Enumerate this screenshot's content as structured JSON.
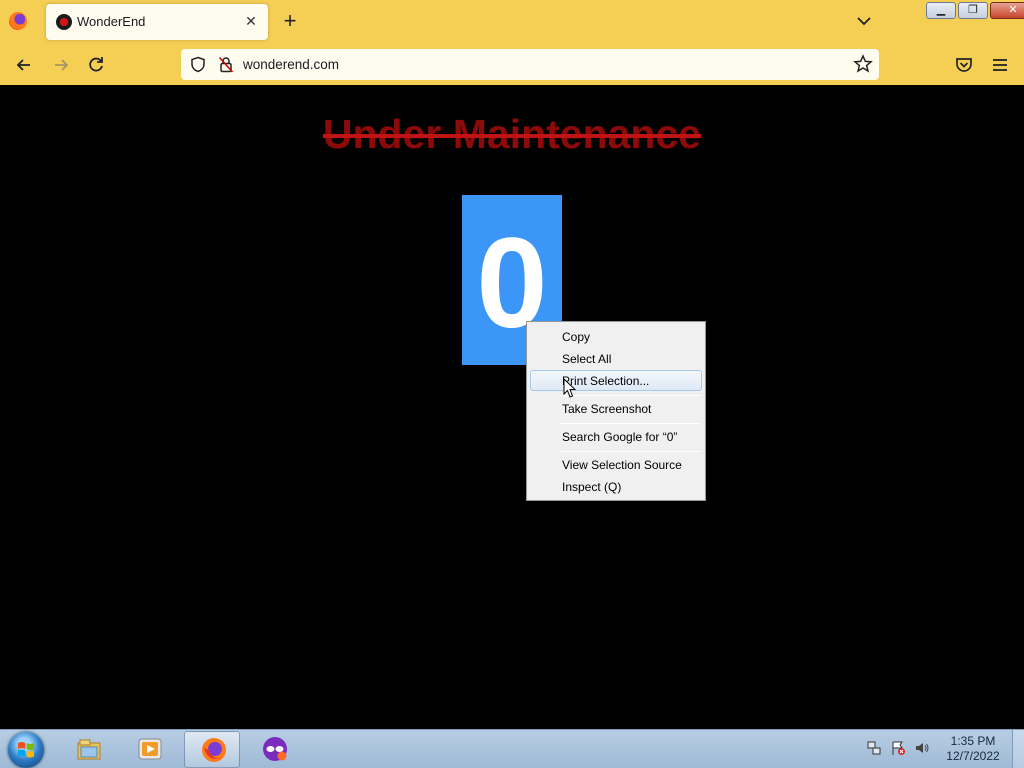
{
  "browser": {
    "tab": {
      "title": "WonderEnd"
    },
    "url": "wonderend.com"
  },
  "page": {
    "headline": "Under Maintenance",
    "counter_value": "0"
  },
  "context_menu": {
    "items": [
      {
        "label": "Copy"
      },
      {
        "label": "Select All"
      },
      {
        "label": "Print Selection..."
      },
      {
        "label": "Take Screenshot"
      },
      {
        "label": "Search Google for “0”"
      },
      {
        "label": "View Selection Source"
      },
      {
        "label": "Inspect (Q)"
      }
    ],
    "highlighted": "Print Selection..."
  },
  "taskbar": {
    "clock": {
      "time": "1:35 PM",
      "date": "12/7/2022"
    },
    "pinned": [
      "file-explorer-icon",
      "media-player-icon",
      "firefox-icon",
      "private-browsing-icon"
    ]
  },
  "colors": {
    "toolbar": "#f5cf54",
    "headline": "#8c0a0a",
    "counter_bg": "#3b96f7"
  }
}
